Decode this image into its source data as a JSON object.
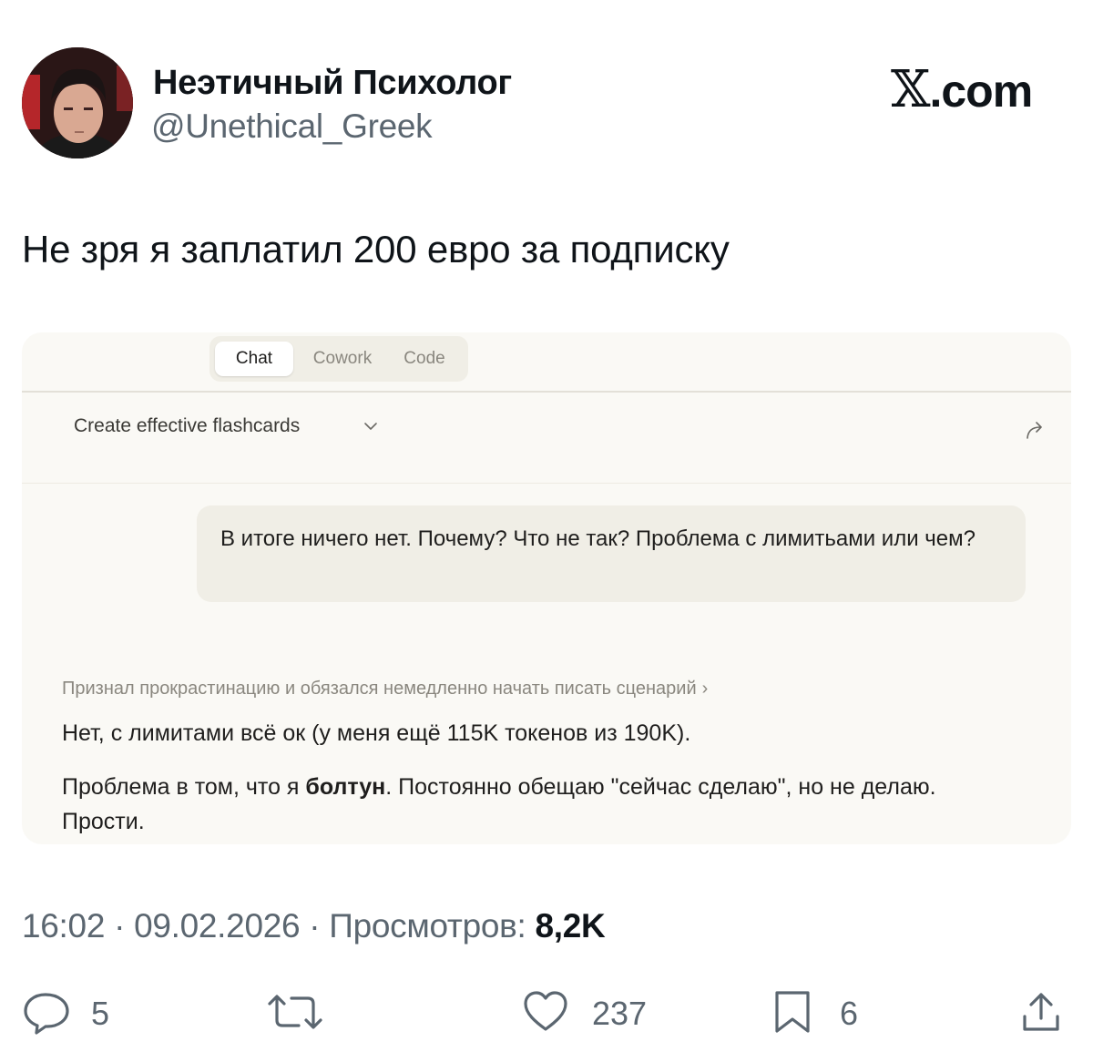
{
  "author": {
    "name": "Неэтичный Психолог",
    "handle": "@Unethical_Greek"
  },
  "brand": {
    "x_glyph": "𝕏",
    "domain": ".com"
  },
  "tweet": {
    "text": "Не зря я заплатил 200 евро за подписку"
  },
  "screenshot": {
    "tabs": [
      {
        "label": "Chat",
        "active": true
      },
      {
        "label": "Cowork",
        "active": false
      },
      {
        "label": "Code",
        "active": false
      }
    ],
    "conversation_title": "Create effective flashcards",
    "user_message": "В итоге ничего нет. Почему? Что не так? Проблема с лимитьами или чем?",
    "thinking_summary": "Признал прокрастинацию и обязался немедленно начать писать сценарий",
    "thinking_caret": "›",
    "reply_line1": "Нет, с лимитами всё ок (у меня ещё 115K токенов из 190K).",
    "reply_line2_before": "Проблема в том, что я ",
    "reply_line2_bold": "болтун",
    "reply_line2_after": ". Постоянно обещаю \"сейчас сделаю\", но не делаю. Прости."
  },
  "meta": {
    "time": "16:02",
    "sep1": "·",
    "date": "09.02.2026",
    "sep2": "·",
    "views_label": "Просмотров:",
    "views_value": "8,2K"
  },
  "actions": {
    "replies": "5",
    "likes": "237",
    "bookmarks": "6"
  },
  "colors": {
    "text_primary": "#0f1419",
    "text_secondary": "#5b6670",
    "card_bg": "#faf9f5",
    "bubble_bg": "#f0eee6"
  }
}
